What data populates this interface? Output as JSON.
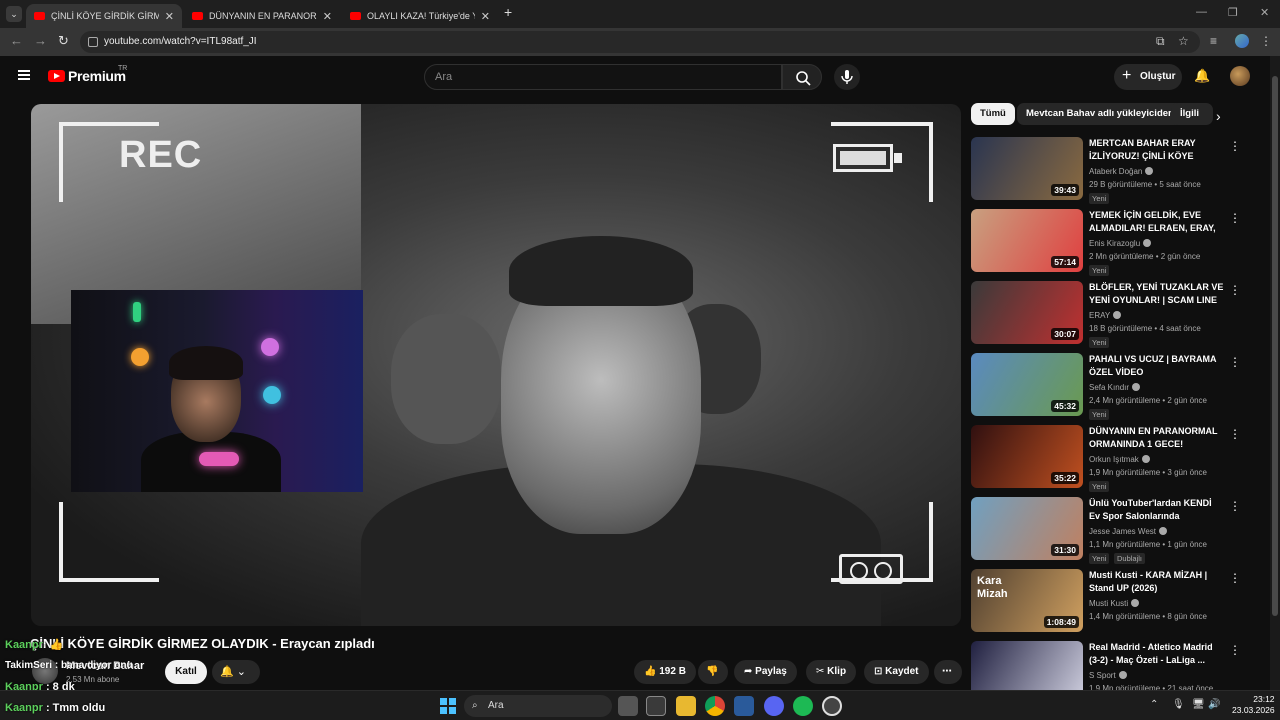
{
  "browser": {
    "tabs": [
      {
        "title": "ÇİNLİ KÖYE GİRDİK GİRMEZ OL",
        "active": true
      },
      {
        "title": "DÜNYANIN EN PARANORMAL",
        "active": false
      },
      {
        "title": "OLAYLI KAZA! Türkiye'de Yaşan",
        "active": false
      }
    ],
    "url": "youtube.com/watch?v=ITL98atf_JI"
  },
  "youtube": {
    "logo": "Premium",
    "logo_tr": "TR",
    "search_placeholder": "Ara",
    "create_label": "Oluştur"
  },
  "video": {
    "overlay_rec": "REC",
    "title": "ÇİNLİ KÖYE GİRDİK GİRMEZ OLAYDIK - Eraycan zıpladı",
    "channel": "Mevtcan Bahar",
    "subscribers": "2,53 Mn abone",
    "join_label": "Katıl",
    "likes": "192 B",
    "share_label": "Paylaş",
    "clip_label": "Klip",
    "save_label": "Kaydet"
  },
  "chat": [
    {
      "user": "Kaanpr",
      "msg": ": 👍"
    },
    {
      "user": "",
      "msg": "TakimSeri : bana diyor onu"
    },
    {
      "user": "Kaanpr",
      "msg": " : 8 dk"
    },
    {
      "user": "Kaanpr",
      "msg": " : Tmm oldu"
    }
  ],
  "chips": [
    "Tümü",
    "Mevtcan Bahav adlı yükleyiciden",
    "İlgili"
  ],
  "recommendations": [
    {
      "title": "MERTCAN BAHAR ERAY İZLİYORUZ! ÇİNLİ KÖYE GİRDİ...",
      "channel": "Ataberk Doğan",
      "meta": "29 B görüntüleme • 5 saat önce",
      "badge": "Yeni",
      "duration": "39:43",
      "colors": [
        "#2a3550",
        "#8a6a40"
      ]
    },
    {
      "title": "YEMEK İÇİN GELDİK, EVE ALMADILAR! ELRAEN, ERAY, ...",
      "channel": "Enis Kirazoglu",
      "meta": "2 Mn görüntüleme • 2 gün önce",
      "badge": "Yeni",
      "duration": "57:14",
      "colors": [
        "#c8a080",
        "#e04040"
      ]
    },
    {
      "title": "BLÖFLER, YENİ TUZAKLAR VE YENİ OYUNLAR! | SCAM LINE",
      "channel": "ERAY",
      "meta": "18 B görüntüleme • 4 saat önce",
      "badge": "Yeni",
      "duration": "30:07",
      "colors": [
        "#3a3a3a",
        "#c03030"
      ]
    },
    {
      "title": "PAHALI VS UCUZ | BAYRAMA ÖZEL VİDEO",
      "channel": "Sefa Kındır",
      "meta": "2,4 Mn görüntüleme • 2 gün önce",
      "badge": "Yeni",
      "duration": "45:32",
      "colors": [
        "#5a8ac0",
        "#6a9a50"
      ]
    },
    {
      "title": "DÜNYANIN EN PARANORMAL ORMANINDA 1 GECE!",
      "channel": "Orkun Işıtmak",
      "meta": "1,9 Mn görüntüleme • 3 gün önce",
      "badge": "Yeni",
      "duration": "35:22",
      "colors": [
        "#301010",
        "#c05020"
      ]
    },
    {
      "title": "Ünlü YouTuber'lardan KENDİ Ev Spor Salonlarında Antrenman ...",
      "channel": "Jesse James West",
      "meta": "1,1 Mn görüntüleme • 1 gün önce",
      "badge": "Yeni",
      "badge2": "Dublajlı",
      "duration": "31:30",
      "colors": [
        "#70a0c0",
        "#c08060"
      ]
    },
    {
      "title": "Musti Kusti - KARA MİZAH | Stand UP (2026)",
      "channel": "Musti Kusti",
      "meta": "1,4 Mn görüntüleme • 8 gün önce",
      "badge": "",
      "duration": "1:08:49",
      "colors": [
        "#504030",
        "#d0a060"
      ],
      "thumb_text": "Kara Mizah"
    },
    {
      "title": "Real Madrid - Atletico Madrid (3-2) - Maç Özeti - LaLiga ...",
      "channel": "S Sport",
      "meta": "1,9 Mn görüntüleme • 21 saat önce",
      "badge": "",
      "duration": "",
      "colors": [
        "#202040",
        "#d0d0e0"
      ]
    }
  ],
  "taskbar": {
    "search_placeholder": "Ara",
    "time": "23:12",
    "date": "23.03.2026"
  }
}
